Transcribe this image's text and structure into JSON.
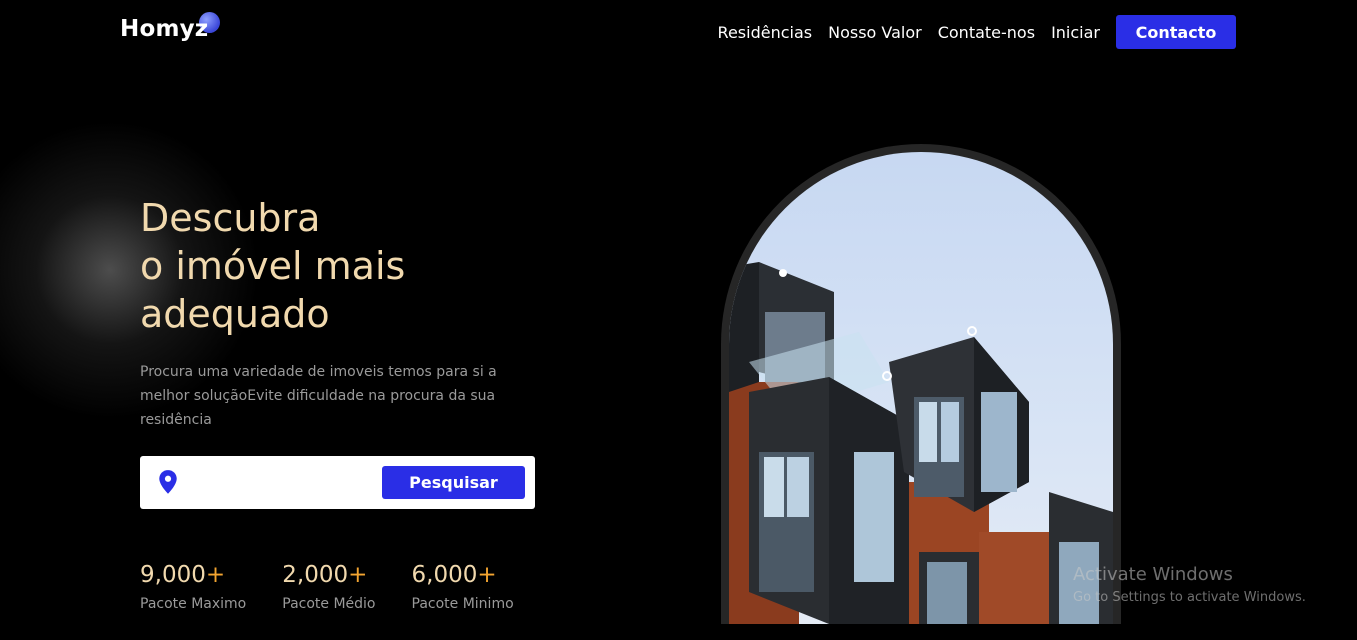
{
  "header": {
    "logo": "Homyz",
    "nav": [
      "Residências",
      "Nosso Valor",
      "Contate-nos",
      "Iniciar"
    ],
    "cta": "Contacto"
  },
  "hero": {
    "title_lines": [
      "Descubra",
      "o imóvel mais",
      "adequado"
    ],
    "description": "Procura uma variedade de imoveis temos para si a melhor soluçãoEvite dificuldade na procura da sua residência",
    "search": {
      "placeholder": "",
      "value": "",
      "button": "Pesquisar"
    },
    "stats": [
      {
        "value": "9,000",
        "suffix": "+",
        "label": "Pacote Maximo"
      },
      {
        "value": "2,000",
        "suffix": "+",
        "label": "Pacote Médio"
      },
      {
        "value": "6,000",
        "suffix": "+",
        "label": "Pacote Minimo"
      }
    ]
  },
  "watermark": {
    "title": "Activate Windows",
    "subtitle": "Go to Settings to activate Windows."
  },
  "colors": {
    "accent": "#2a2ee6",
    "title": "#f1d9ae",
    "plus": "#f3a531"
  },
  "icons": {
    "search_field": "location-pin-icon"
  }
}
